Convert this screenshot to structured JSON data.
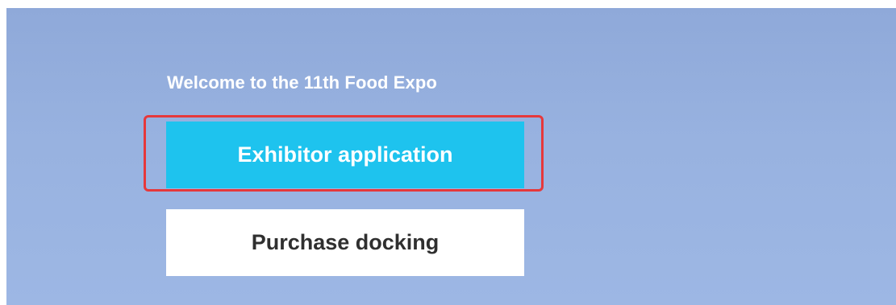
{
  "page": {
    "welcome_text": "Welcome to the 11th Food Expo"
  },
  "buttons": {
    "exhibitor_label": "Exhibitor application",
    "purchase_label": "Purchase docking"
  },
  "colors": {
    "background": "#9ab3e1",
    "exhibitor_button": "#1ec3ee",
    "purchase_button": "#ffffff",
    "highlight": "#e6383b"
  }
}
